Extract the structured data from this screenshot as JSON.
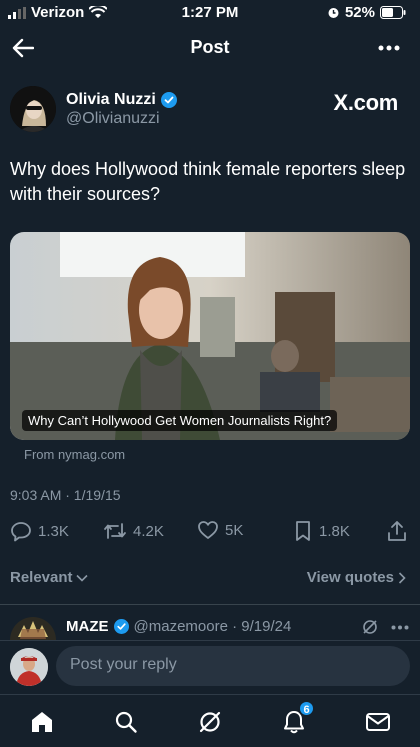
{
  "status_bar": {
    "carrier": "Verizon",
    "time": "1:27 PM",
    "battery": "52%"
  },
  "header": {
    "title": "Post"
  },
  "author": {
    "name": "Olivia Nuzzi",
    "handle": "@Olivianuzzi",
    "verified": true
  },
  "brand": {
    "label": "X.com"
  },
  "tweet": {
    "text": "Why does Hollywood think female reporters sleep with their sources?"
  },
  "card": {
    "caption": "Why Can’t Hollywood Get Women Journalists Right?",
    "source": "From nymag.com"
  },
  "timestamp": "9:03 AM · 1/19/15",
  "actions": {
    "replies": "1.3K",
    "reposts": "4.2K",
    "likes": "5K",
    "bookmarks": "1.8K"
  },
  "sort": {
    "relevant": "Relevant",
    "view_quotes": "View quotes"
  },
  "reply_preview": {
    "name": "MAZE",
    "handle": "@mazemoore · 9/19/24",
    "verified": true
  },
  "compose": {
    "placeholder": "Post your reply"
  },
  "tabbar": {
    "notifications_badge": "6"
  },
  "colors": {
    "background": "#15202b",
    "accent": "#1d9bf0",
    "muted": "#8b98a5"
  }
}
